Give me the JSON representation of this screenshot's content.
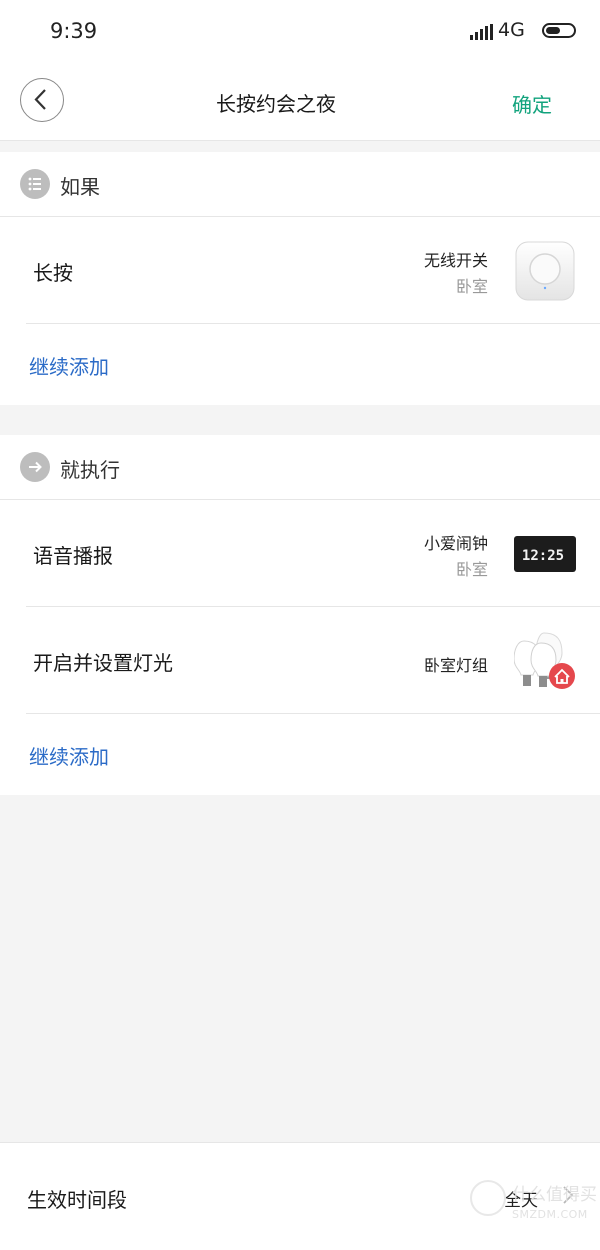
{
  "status_bar": {
    "time": "9:39",
    "network": "4G"
  },
  "header": {
    "title": "长按约会之夜",
    "confirm_label": "确定"
  },
  "if_section": {
    "heading": "如果",
    "items": [
      {
        "label": "长按",
        "device_name": "无线开关",
        "room": "卧室",
        "device_icon": "wireless-switch-icon"
      }
    ],
    "add_label": "继续添加"
  },
  "then_section": {
    "heading": "就执行",
    "items": [
      {
        "label": "语音播报",
        "device_name": "小爱闹钟",
        "room": "卧室",
        "device_icon": "alarm-clock-icon",
        "clock_display": "12:25"
      },
      {
        "label": "开启并设置灯光",
        "device_name": "卧室灯组",
        "device_icon": "bulb-group-icon"
      }
    ],
    "add_label": "继续添加"
  },
  "effective_period": {
    "label": "生效时间段",
    "value": "全天"
  },
  "watermark": {
    "text_cn": "什么值得买",
    "text_en": "SMZDM.COM"
  },
  "colors": {
    "accent_green": "#12a37d",
    "link_blue": "#2b6bc7",
    "badge_red": "#e5484d"
  }
}
